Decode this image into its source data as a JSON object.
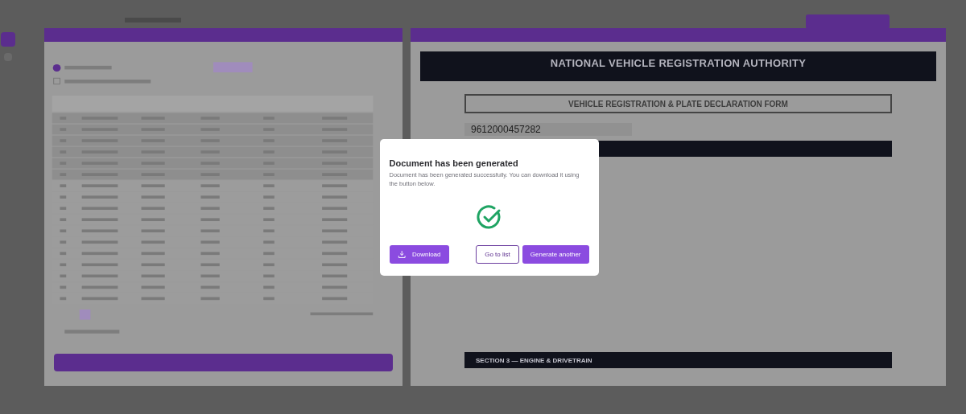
{
  "background": {
    "document": {
      "authority": "NATIONAL VEHICLE REGISTRATION AUTHORITY",
      "form_title": "VEHICLE REGISTRATION & PLATE DECLARATION FORM",
      "reference_number": "9612000457282",
      "section": "SECTION 3 — ENGINE & DRIVETRAIN"
    }
  },
  "dialog": {
    "title": "Document has been generated",
    "message": "Document has been generated successfully. You can download it using the button below.",
    "buttons": [
      {
        "kind": "download",
        "label": "Download"
      },
      {
        "kind": "outline",
        "label": "Go to list"
      },
      {
        "kind": "primary",
        "label": "Generate another"
      }
    ]
  }
}
